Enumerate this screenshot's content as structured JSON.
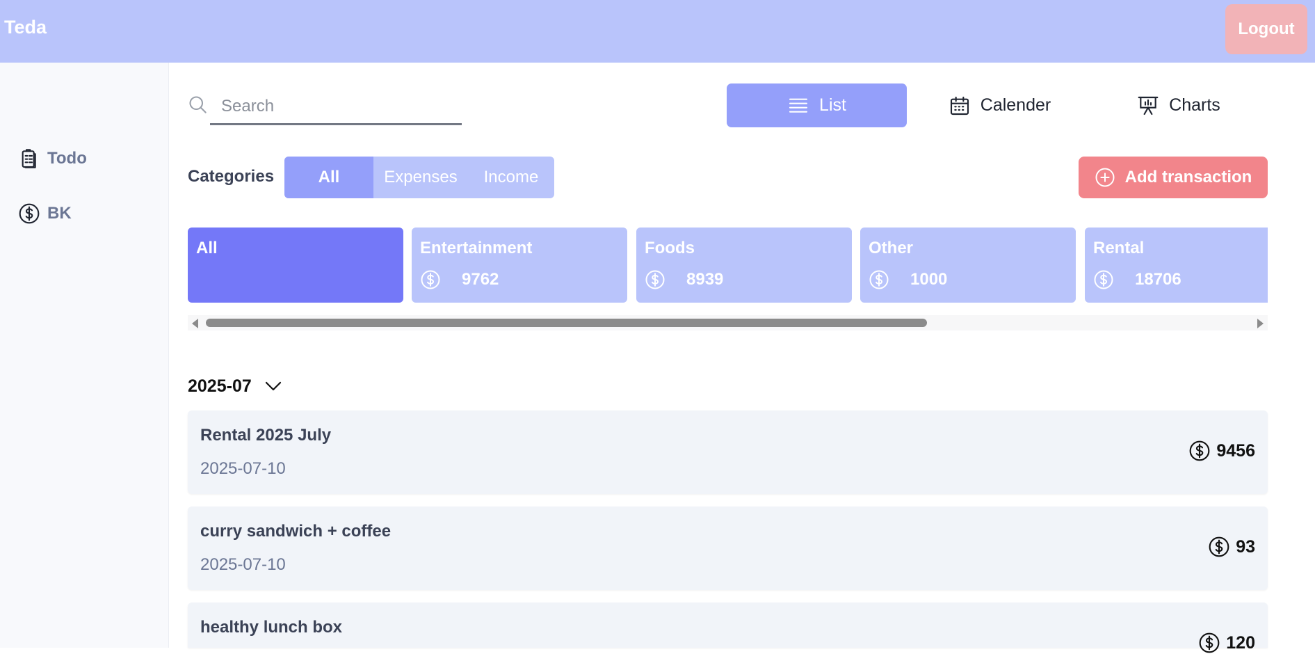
{
  "header": {
    "brand": "Teda",
    "logout_label": "Logout"
  },
  "sidebar": {
    "items": [
      {
        "label": "Todo",
        "icon": "clipboard-icon"
      },
      {
        "label": "BK",
        "icon": "dollar-icon"
      }
    ]
  },
  "search": {
    "placeholder": "Search",
    "value": ""
  },
  "views": [
    {
      "label": "List",
      "icon": "list-icon",
      "active": true
    },
    {
      "label": "Calender",
      "icon": "calendar-icon",
      "active": false
    },
    {
      "label": "Charts",
      "icon": "presentation-chart-icon",
      "active": false
    }
  ],
  "categories": {
    "label": "Categories",
    "filters": [
      "All",
      "Expenses",
      "Income"
    ],
    "active_filter": "All"
  },
  "add_transaction_label": "Add transaction",
  "category_cards": [
    {
      "name": "All",
      "amount": "",
      "active": true
    },
    {
      "name": "Entertainment",
      "amount": "9762",
      "active": false
    },
    {
      "name": "Foods",
      "amount": "8939",
      "active": false
    },
    {
      "name": "Other",
      "amount": "1000",
      "active": false
    },
    {
      "name": "Rental",
      "amount": "18706",
      "active": false
    }
  ],
  "month_group": {
    "label": "2025-07"
  },
  "transactions": [
    {
      "title": "Rental 2025 July",
      "date": "2025-07-10",
      "amount": "9456"
    },
    {
      "title": "curry sandwich + coffee",
      "date": "2025-07-10",
      "amount": "93"
    },
    {
      "title": "healthy lunch box",
      "date": "",
      "amount": "120"
    }
  ],
  "colors": {
    "header": "#b9c4fb",
    "accent": "#949ffa",
    "active_card": "#7478f8",
    "logout": "#f2b3b7",
    "add_button": "#f2858b"
  }
}
